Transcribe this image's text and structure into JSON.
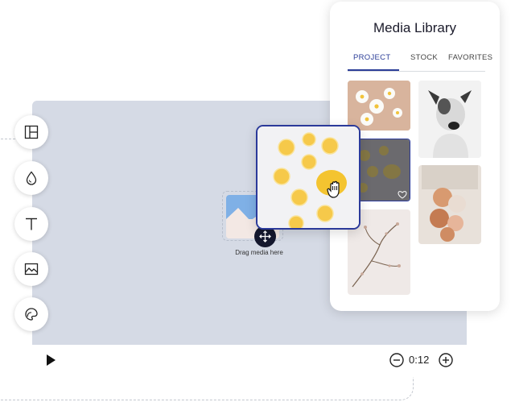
{
  "library": {
    "title": "Media Library",
    "tabs": [
      {
        "label": "PROJECT",
        "active": true
      },
      {
        "label": "STOCK",
        "active": false
      },
      {
        "label": "FAVORITES",
        "active": false
      }
    ],
    "thumbnails": [
      "daisies-on-peach",
      "dog-portrait",
      "lemons-dimmed",
      "rose-gold-balloons",
      "dried-branch"
    ]
  },
  "canvas": {
    "drop_caption": "Drag media here"
  },
  "playback": {
    "time": "0:12"
  },
  "tools": [
    "layout-icon",
    "drop-icon",
    "text-icon",
    "image-icon",
    "palette-icon"
  ],
  "colors": {
    "accent": "#2c3e98",
    "canvas_bg": "#d5dae5",
    "handle": "#15182e"
  }
}
